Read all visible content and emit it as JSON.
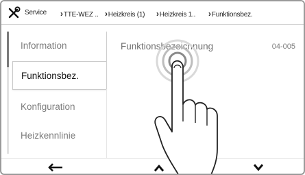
{
  "header": {
    "icon": "tools-icon",
    "breadcrumb": [
      "Service",
      "TTE-WEZ ..",
      "Heizkreis (1)",
      "Heizkreis 1..",
      "Funktionsbez."
    ]
  },
  "menu": {
    "items": [
      {
        "label": "Information",
        "selected": false
      },
      {
        "label": "Funktionsbez.",
        "selected": true
      },
      {
        "label": "Konfiguration",
        "selected": false
      },
      {
        "label": "Heizkennlinie",
        "selected": false
      }
    ]
  },
  "content": {
    "title": "Funktionsbezeichnung",
    "code": "04-005"
  },
  "footer": {
    "back_icon": "back-arrow-icon",
    "up_icon": "chevron-up-icon",
    "down_icon": "chevron-down-icon"
  },
  "overlay": {
    "icon": "tap-gesture-icon"
  }
}
